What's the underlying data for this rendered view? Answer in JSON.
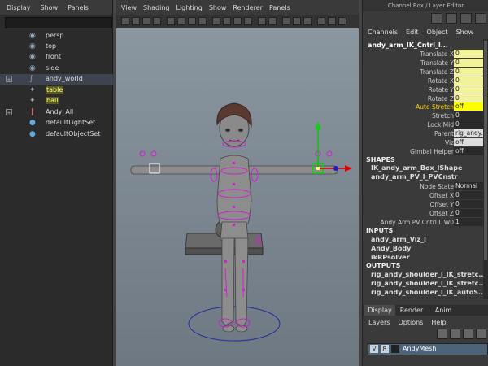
{
  "outliner": {
    "menu": [
      "Display",
      "Show",
      "Panels"
    ],
    "items": [
      {
        "label": "persp",
        "icon": "camera-icon",
        "expand": ""
      },
      {
        "label": "top",
        "icon": "camera-icon",
        "expand": ""
      },
      {
        "label": "front",
        "icon": "camera-icon",
        "expand": ""
      },
      {
        "label": "side",
        "icon": "camera-icon",
        "expand": ""
      },
      {
        "label": "andy_world",
        "icon": "curve-icon",
        "expand": "+"
      },
      {
        "label": "table",
        "icon": "mesh-icon",
        "expand": ""
      },
      {
        "label": "ball",
        "icon": "mesh-icon",
        "expand": ""
      },
      {
        "label": "Andy_All",
        "icon": "joint-icon",
        "expand": "+"
      },
      {
        "label": "defaultLightSet",
        "icon": "set-icon",
        "expand": ""
      },
      {
        "label": "defaultObjectSet",
        "icon": "set-icon",
        "expand": ""
      }
    ]
  },
  "viewport": {
    "menu": [
      "View",
      "Shading",
      "Lighting",
      "Show",
      "Renderer",
      "Panels"
    ]
  },
  "channel_box": {
    "title": "Channel Box / Layer Editor",
    "menu": [
      "Channels",
      "Edit",
      "Object",
      "Show"
    ],
    "object_name": "andy_arm_IK_Cntrl_l...",
    "attributes": [
      {
        "name": "Translate X",
        "value": "0"
      },
      {
        "name": "Translate Y",
        "value": "0"
      },
      {
        "name": "Translate Z",
        "value": "0"
      },
      {
        "name": "Rotate X",
        "value": "0"
      },
      {
        "name": "Rotate Y",
        "value": "0"
      },
      {
        "name": "Rotate Z",
        "value": "0"
      },
      {
        "name": "Auto Stretch",
        "value": "off"
      },
      {
        "name": "Stretch",
        "value": "0"
      },
      {
        "name": "Lock Mid",
        "value": "0"
      },
      {
        "name": "Parent",
        "value": "rig_andy..."
      },
      {
        "name": "Viz",
        "value": "off"
      },
      {
        "name": "Gimbal Helper",
        "value": "off"
      }
    ],
    "shapes_label": "SHAPES",
    "shapes": [
      "IK_andy_arm_Box_lShape",
      "andy_arm_PV_l_PVCnstr"
    ],
    "shape_attributes": [
      {
        "name": "Node State",
        "value": "Normal"
      },
      {
        "name": "Offset X",
        "value": "0"
      },
      {
        "name": "Offset Y",
        "value": "0"
      },
      {
        "name": "Offset Z",
        "value": "0"
      },
      {
        "name": "Andy Arm PV Cntrl L W0",
        "value": "1"
      }
    ],
    "inputs_label": "INPUTS",
    "inputs": [
      "andy_arm_Viz_l",
      "Andy_Body",
      "ikRPsolver"
    ],
    "outputs_label": "OUTPUTS",
    "outputs": [
      "rig_andy_shoulder_l_IK_stretc...",
      "rig_andy_shoulder_l_IK_stretc...",
      "rig_andy_shoulder_l_IK_autoS..."
    ]
  },
  "layer_editor": {
    "tabs": [
      "Display",
      "Render",
      "Anim"
    ],
    "menu": [
      "Layers",
      "Options",
      "Help"
    ],
    "layer": {
      "v": "V",
      "r": "R",
      "name": "AndyMesh"
    }
  },
  "colors": {
    "selection_yellow": "#ffff00",
    "key_yellow": "#f2f29a",
    "viewport_bg": "#7f8a94",
    "manip_magenta": "#d020d0"
  }
}
